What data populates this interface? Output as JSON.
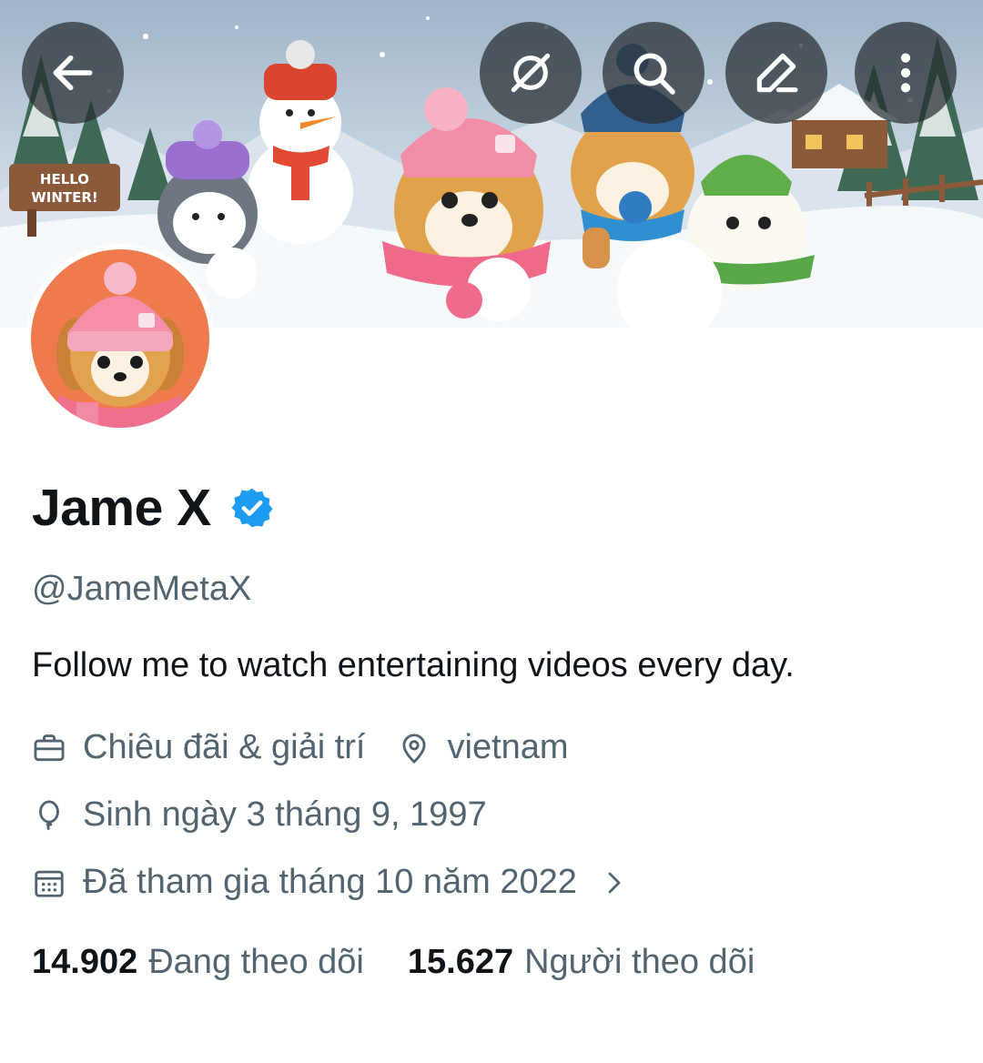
{
  "profile": {
    "display_name": "Jame X",
    "handle": "@JameMetaX",
    "bio": "Follow me to watch entertaining videos every day.",
    "category": "Chiêu đãi & giải trí",
    "location": "vietnam",
    "birthday": "Sinh ngày 3 tháng 9, 1997",
    "joined": "Đã tham gia tháng 10 năm 2022",
    "verified": true
  },
  "stats": {
    "following_count": "14.902",
    "following_label": "Đang theo dõi",
    "followers_count": "15.627",
    "followers_label": "Người theo dõi"
  },
  "banner": {
    "sign_text": "HELLO WINTER!"
  },
  "icons": {
    "back": "arrow-left-icon",
    "grok": "grok-icon",
    "search": "search-icon",
    "edit": "pencil-icon",
    "more": "more-vertical-icon",
    "verified": "verified-badge-icon",
    "category": "briefcase-icon",
    "location": "location-pin-icon",
    "birthday": "balloon-icon",
    "joined": "calendar-icon",
    "chevron": "chevron-right-icon"
  },
  "colors": {
    "verified_blue": "#1d9bf0",
    "text_primary": "#0f1419",
    "text_secondary": "#536471",
    "avatar_bg": "#ee7a4e"
  }
}
